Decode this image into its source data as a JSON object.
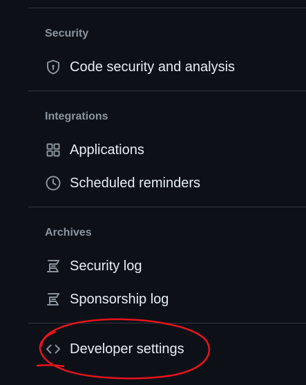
{
  "sections": [
    {
      "heading": "Security",
      "items": [
        {
          "label": "Code security and analysis",
          "icon": "shield-lock-icon"
        }
      ]
    },
    {
      "heading": "Integrations",
      "items": [
        {
          "label": "Applications",
          "icon": "apps-grid-icon"
        },
        {
          "label": "Scheduled reminders",
          "icon": "clock-icon"
        }
      ]
    },
    {
      "heading": "Archives",
      "items": [
        {
          "label": "Security log",
          "icon": "log-icon"
        },
        {
          "label": "Sponsorship log",
          "icon": "log-icon"
        }
      ]
    }
  ],
  "developer": {
    "label": "Developer settings",
    "icon": "code-icon"
  },
  "annotation": {
    "color": "#e8131b",
    "shape": "hand-drawn-ellipse"
  }
}
